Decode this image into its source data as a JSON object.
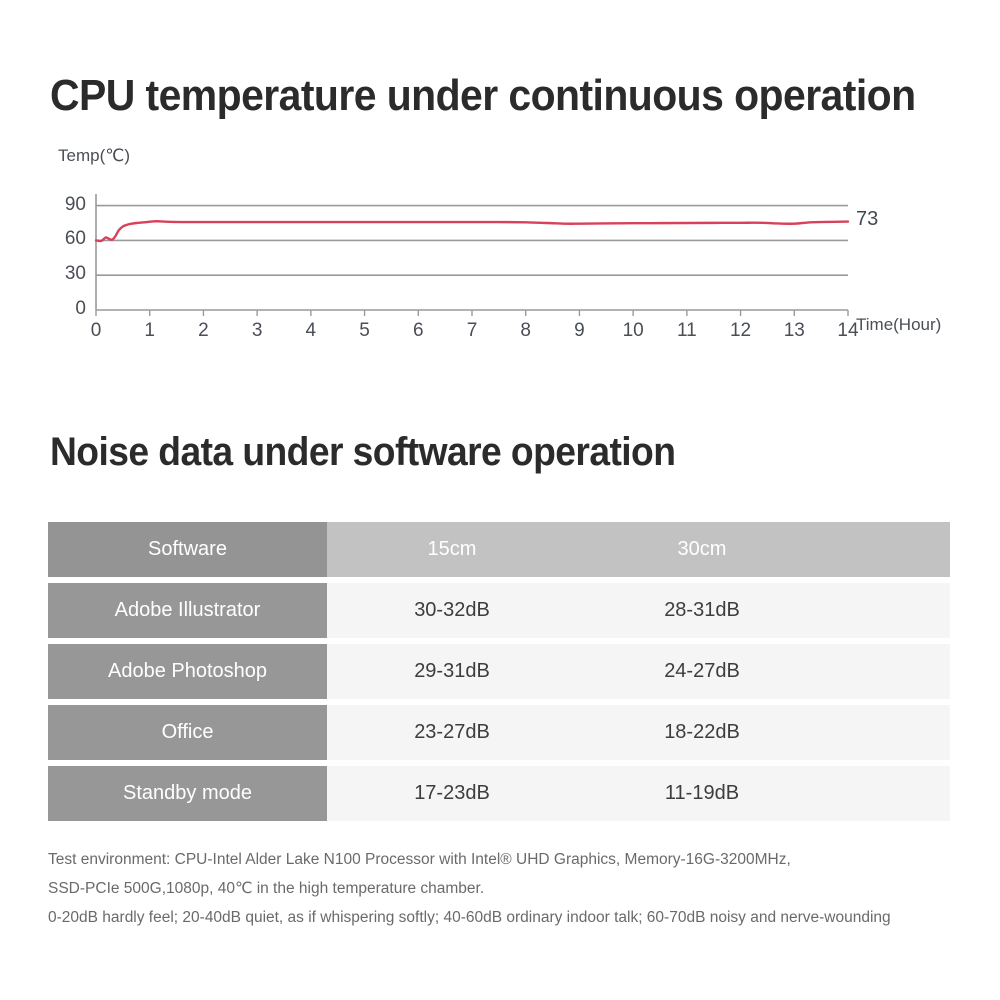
{
  "chart_section": {
    "title": "CPU temperature under continuous operation",
    "y_axis_label": "Temp(℃)",
    "x_axis_label": "Time(Hour)",
    "endpoint_value": "73"
  },
  "table_section": {
    "title": "Noise data under software operation",
    "columns": [
      "Software",
      "15cm",
      "30cm"
    ],
    "rows": [
      {
        "software": "Adobe Illustrator",
        "d15": "30-32dB",
        "d30": "28-31dB"
      },
      {
        "software": "Adobe Photoshop",
        "d15": "29-31dB",
        "d30": "24-27dB"
      },
      {
        "software": "Office",
        "d15": "23-27dB",
        "d30": "18-22dB"
      },
      {
        "software": "Standby mode",
        "d15": "17-23dB",
        "d30": "11-19dB"
      }
    ]
  },
  "footnote": {
    "line1": "Test environment: CPU-Intel Alder Lake N100 Processor with Intel® UHD Graphics,  Memory-16G-3200MHz,",
    "line2": "SSD-PCIe 500G,1080p, 40℃ in the high temperature chamber.",
    "line3": "0-20dB hardly feel; 20-40dB quiet, as if whispering softly; 40-60dB ordinary indoor talk; 60-70dB noisy and nerve-wounding"
  },
  "colors": {
    "line": "#d7415b",
    "grid": "#9a9a9a",
    "header_label_bg": "#949494",
    "header_value_bg": "#c2c2c2",
    "row_label_bg": "#979797",
    "row_value_bg": "#f5f5f5",
    "title": "#2b2b2b",
    "footnote": "#6a6a6a"
  },
  "chart_data": {
    "type": "line",
    "title": "CPU temperature under continuous operation",
    "xlabel": "Time(Hour)",
    "ylabel": "Temp(℃)",
    "xlim": [
      0,
      14
    ],
    "ylim": [
      0,
      100
    ],
    "xticks": [
      "0",
      "1",
      "2",
      "3",
      "4",
      "5",
      "6",
      "7",
      "8",
      "9",
      "10",
      "11",
      "12",
      "13",
      "14"
    ],
    "yticks": [
      "0",
      "30",
      "60",
      "90"
    ],
    "grid": true,
    "legend": "none",
    "annotations": [
      {
        "text": "73",
        "x": 14,
        "y": 76,
        "position": "right-of-line-end"
      }
    ],
    "series": [
      {
        "name": "CPU temperature",
        "color": "#d7415b",
        "x": [
          0.0,
          0.1,
          0.18,
          0.24,
          0.3,
          0.36,
          0.42,
          0.5,
          0.6,
          0.75,
          0.9,
          1.05,
          1.15,
          1.3,
          1.6,
          2.0,
          2.5,
          3.0,
          3.5,
          4.0,
          4.5,
          5.0,
          5.5,
          6.0,
          6.5,
          7.0,
          7.5,
          8.0,
          8.4,
          8.75,
          9.0,
          9.4,
          10.0,
          10.5,
          11.0,
          11.5,
          12.0,
          12.4,
          12.7,
          13.0,
          13.25,
          13.6,
          14.0
        ],
        "y": [
          60.0,
          59.6,
          62.5,
          61.4,
          60.6,
          63.5,
          68.5,
          72.0,
          73.8,
          75.0,
          75.6,
          76.3,
          76.5,
          76.1,
          75.8,
          75.8,
          75.8,
          75.8,
          75.8,
          75.8,
          75.8,
          75.8,
          75.8,
          75.8,
          75.8,
          75.8,
          75.8,
          75.6,
          75.0,
          74.4,
          74.4,
          74.6,
          74.8,
          74.9,
          75.0,
          75.1,
          75.2,
          75.2,
          74.6,
          74.4,
          75.4,
          75.9,
          76.2
        ]
      }
    ]
  }
}
